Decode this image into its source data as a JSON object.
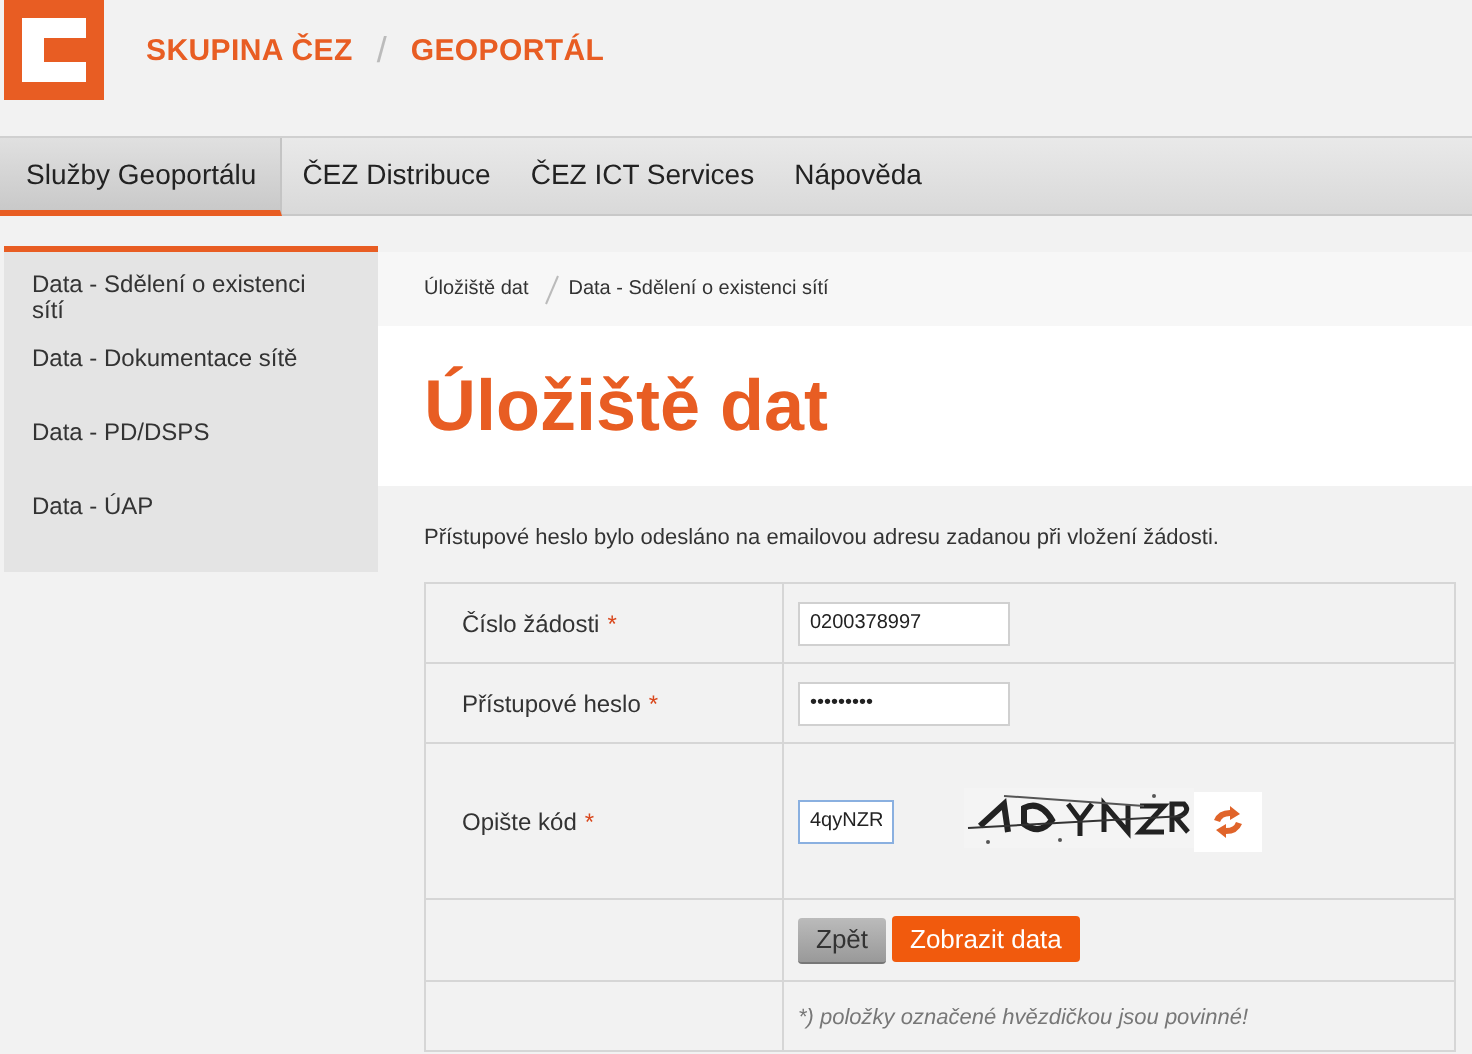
{
  "header": {
    "brand": "SKUPINA ČEZ",
    "separator": "/",
    "product": "GEOPORTÁL"
  },
  "nav": [
    {
      "label": "Služby Geoportálu",
      "selected": true
    },
    {
      "label": "ČEZ Distribuce",
      "selected": false
    },
    {
      "label": "ČEZ ICT Services",
      "selected": false
    },
    {
      "label": "Nápověda",
      "selected": false
    }
  ],
  "sidebar": {
    "items": [
      {
        "label": "Data - Sdělení o existenci sítí"
      },
      {
        "label": "Data - Dokumentace sítě"
      },
      {
        "label": "Data - PD/DSPS"
      },
      {
        "label": "Data - ÚAP"
      }
    ]
  },
  "breadcrumb": [
    "Úložiště dat",
    "Data - Sdělení o existenci sítí"
  ],
  "title": "Úložiště dat",
  "info": "Přístupové heslo bylo odesláno na emailovou adresu zadanou při vložení žádosti.",
  "form": {
    "fields": [
      {
        "kind": "text",
        "label": "Číslo žádosti",
        "required": true,
        "value": "0200378997",
        "focused": false
      },
      {
        "kind": "text",
        "label": "Přístupové heslo",
        "required": true,
        "value": "•••••••••",
        "focused": false
      },
      {
        "kind": "captcha",
        "label": "Opište kód",
        "required": true,
        "value": "4qyNZR",
        "focused": true
      }
    ],
    "required_mark": "*",
    "buttons": [
      {
        "kind": "secondary",
        "label": "Zpět"
      },
      {
        "kind": "primary",
        "label": "Zobrazit data"
      }
    ],
    "note": "*) položky označené hvězdičkou jsou povinné!"
  }
}
